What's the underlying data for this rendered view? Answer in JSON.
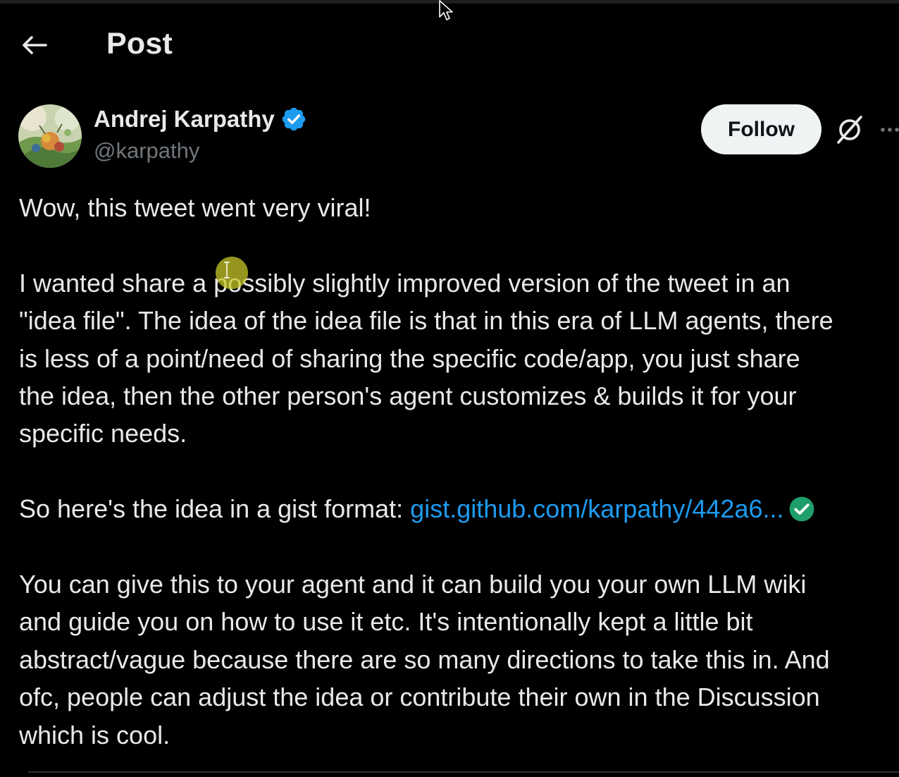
{
  "header": {
    "title": "Post",
    "back_icon": "arrow-left-icon"
  },
  "author": {
    "name": "Andrej Karpathy",
    "handle": "@karpathy",
    "verified": true,
    "verified_color": "#1d9bf0",
    "avatar_icon": "avatar-illustration"
  },
  "actions": {
    "follow_label": "Follow",
    "grok_icon": "grok-icon",
    "more_icon": "more-horizontal-icon"
  },
  "post": {
    "line_1": "Wow, this tweet went very viral!",
    "para_2_lines": [
      "I wanted share a possibly slightly improved version of the tweet in an",
      "\"idea file\". The idea of the idea file is that in this era of LLM agents, there",
      "is less of a point/need of sharing the specific code/app, you just share",
      "the idea, then the other person's agent customizes & builds it for your",
      "specific needs."
    ],
    "gist_prefix": "So here's the idea in a gist format: ",
    "gist_link": "gist.github.com/karpathy/442a6...",
    "para_4_lines": [
      "You can give this to your agent and it can build you your own LLM wiki",
      "and guide you on how to use it etc. It's intentionally kept a little bit",
      "abstract/vague because there are so many directions to take this in. And",
      "ofc, people can adjust the idea or contribute their own in the Discussion",
      "which is cool."
    ]
  },
  "colors": {
    "background": "#000000",
    "text": "#e7e9ea",
    "muted": "#71767b",
    "link": "#1d9bf0",
    "follow_bg": "#eff3f4",
    "link_check": "#00ba7c"
  }
}
